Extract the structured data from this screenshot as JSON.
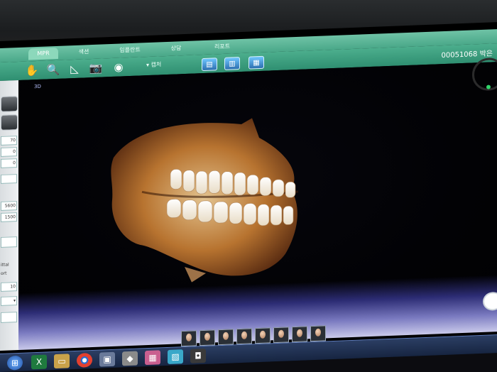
{
  "ribbon": {
    "tabs": [
      "MPR",
      "색션",
      "임플란트",
      "상담",
      "리포트"
    ]
  },
  "toolbar": {
    "dropdown_label": "캡처",
    "case_id": "00051068",
    "patient_name": "박은"
  },
  "viewport": {
    "view_label": "3D"
  },
  "sidebar": {
    "fields": [
      "70",
      "0",
      "0",
      "5600",
      "1500",
      "10"
    ],
    "labels": [
      "ittal",
      "ort"
    ]
  },
  "icons": {
    "hand": "hand-icon",
    "magnifier": "zoom-icon",
    "angle": "angle-icon",
    "camera": "camera-icon",
    "capture": "capture-icon",
    "layout": [
      "layout-icon",
      "layout-icon",
      "layout-icon"
    ]
  },
  "thumbnails": {
    "count": 8
  },
  "taskbar": {
    "icons": [
      "start-orb-icon",
      "excel-icon",
      "folder-icon",
      "chrome-icon",
      "app-icon",
      "app-icon",
      "app-icon",
      "app-icon",
      "app-icon"
    ]
  }
}
